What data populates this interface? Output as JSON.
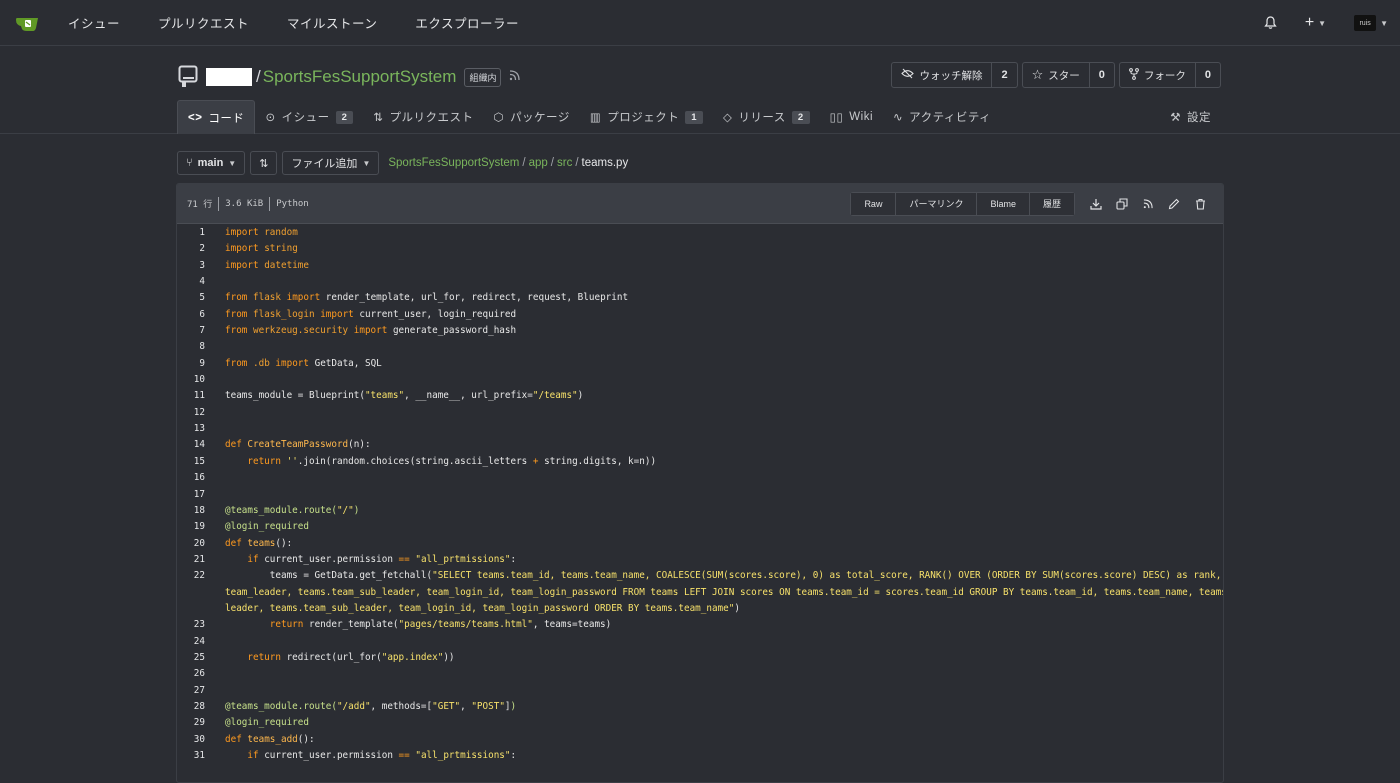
{
  "nav": {
    "items": [
      "イシュー",
      "プルリクエスト",
      "マイルストーン",
      "エクスプローラー"
    ],
    "avatar_text": "ruis"
  },
  "repo": {
    "name": "SportsFesSupportSystem",
    "badge": "組織内",
    "watch_label": "ウォッチ解除",
    "watch_count": "2",
    "star_label": "スター",
    "star_count": "0",
    "fork_label": "フォーク",
    "fork_count": "0"
  },
  "tabs": {
    "code": "コード",
    "issues": "イシュー",
    "issues_count": "2",
    "pulls": "プルリクエスト",
    "packages": "パッケージ",
    "projects": "プロジェクト",
    "projects_count": "1",
    "releases": "リリース",
    "releases_count": "2",
    "wiki": "Wiki",
    "activity": "アクティビティ",
    "settings": "設定"
  },
  "branch": {
    "name": "main",
    "add_file": "ファイル追加"
  },
  "breadcrumb": {
    "repo": "SportsFesSupportSystem",
    "dir1": "app",
    "dir2": "src",
    "file": "teams.py"
  },
  "file": {
    "lines": "71 行",
    "size": "3.6 KiB",
    "language": "Python",
    "btn_raw": "Raw",
    "btn_permalink": "パーマリンク",
    "btn_blame": "Blame",
    "btn_history": "履歴"
  },
  "colors": {
    "accent": "#7ab55c",
    "keyword": "#ff9a1f",
    "string": "#f7e16b",
    "background": "#2b2d33"
  }
}
